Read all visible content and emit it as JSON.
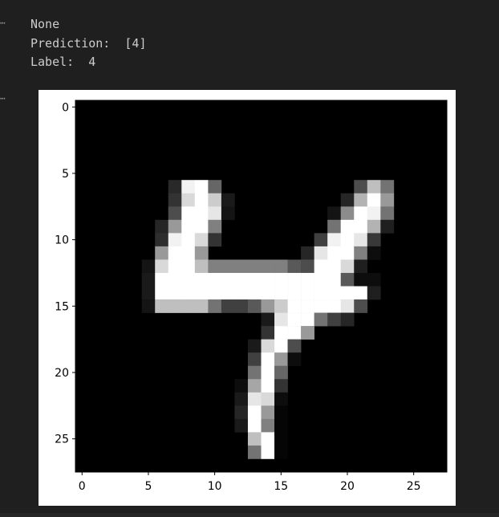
{
  "cells": [
    {
      "gutter_icon": "ellipsis-icon",
      "output_lines": [
        "None",
        "Prediction:  [4]",
        "Label:  4"
      ]
    },
    {
      "gutter_icon": "ellipsis-icon"
    }
  ],
  "chart_data": {
    "type": "heatmap",
    "colormap": "gray",
    "title": "",
    "xlabel": "",
    "ylabel": "",
    "xlim": [
      -0.5,
      27.5
    ],
    "ylim": [
      27.5,
      -0.5
    ],
    "x_ticks": [
      0,
      5,
      10,
      15,
      20,
      25
    ],
    "y_ticks": [
      0,
      5,
      10,
      15,
      20,
      25
    ],
    "grid": false,
    "pixels_nonzero": [
      [
        6,
        7,
        0.16
      ],
      [
        6,
        8,
        0.95
      ],
      [
        6,
        9,
        1.0
      ],
      [
        6,
        10,
        0.4
      ],
      [
        6,
        21,
        0.3
      ],
      [
        6,
        22,
        0.75
      ],
      [
        6,
        23,
        0.45
      ],
      [
        7,
        7,
        0.2
      ],
      [
        7,
        8,
        0.85
      ],
      [
        7,
        9,
        1.0
      ],
      [
        7,
        10,
        0.8
      ],
      [
        7,
        11,
        0.1
      ],
      [
        7,
        20,
        0.15
      ],
      [
        7,
        21,
        0.7
      ],
      [
        7,
        22,
        1.0
      ],
      [
        7,
        23,
        0.6
      ],
      [
        8,
        7,
        0.3
      ],
      [
        8,
        8,
        1.0
      ],
      [
        8,
        9,
        1.0
      ],
      [
        8,
        10,
        0.9
      ],
      [
        8,
        11,
        0.08
      ],
      [
        8,
        19,
        0.08
      ],
      [
        8,
        20,
        0.55
      ],
      [
        8,
        21,
        1.0
      ],
      [
        8,
        22,
        0.95
      ],
      [
        8,
        23,
        0.45
      ],
      [
        9,
        6,
        0.15
      ],
      [
        9,
        7,
        0.6
      ],
      [
        9,
        8,
        1.0
      ],
      [
        9,
        9,
        1.0
      ],
      [
        9,
        10,
        0.5
      ],
      [
        9,
        19,
        0.45
      ],
      [
        9,
        20,
        1.0
      ],
      [
        9,
        21,
        1.0
      ],
      [
        9,
        22,
        0.7
      ],
      [
        9,
        23,
        0.12
      ],
      [
        10,
        6,
        0.18
      ],
      [
        10,
        7,
        0.95
      ],
      [
        10,
        8,
        1.0
      ],
      [
        10,
        9,
        0.85
      ],
      [
        10,
        10,
        0.2
      ],
      [
        10,
        18,
        0.25
      ],
      [
        10,
        19,
        0.95
      ],
      [
        10,
        20,
        1.0
      ],
      [
        10,
        21,
        0.9
      ],
      [
        10,
        22,
        0.22
      ],
      [
        11,
        6,
        0.6
      ],
      [
        11,
        7,
        1.0
      ],
      [
        11,
        8,
        1.0
      ],
      [
        11,
        9,
        0.6
      ],
      [
        11,
        17,
        0.15
      ],
      [
        11,
        18,
        0.9
      ],
      [
        11,
        19,
        1.0
      ],
      [
        11,
        20,
        1.0
      ],
      [
        11,
        21,
        0.5
      ],
      [
        11,
        22,
        0.05
      ],
      [
        12,
        5,
        0.08
      ],
      [
        12,
        6,
        0.85
      ],
      [
        12,
        7,
        1.0
      ],
      [
        12,
        8,
        1.0
      ],
      [
        12,
        9,
        0.75
      ],
      [
        12,
        10,
        0.5
      ],
      [
        12,
        11,
        0.5
      ],
      [
        12,
        12,
        0.5
      ],
      [
        12,
        13,
        0.5
      ],
      [
        12,
        14,
        0.5
      ],
      [
        12,
        15,
        0.5
      ],
      [
        12,
        16,
        0.35
      ],
      [
        12,
        17,
        0.3
      ],
      [
        12,
        18,
        1.0
      ],
      [
        12,
        19,
        1.0
      ],
      [
        12,
        20,
        0.85
      ],
      [
        12,
        21,
        0.12
      ],
      [
        13,
        5,
        0.1
      ],
      [
        13,
        6,
        1.0
      ],
      [
        13,
        7,
        1.0
      ],
      [
        13,
        8,
        1.0
      ],
      [
        13,
        9,
        1.0
      ],
      [
        13,
        10,
        1.0
      ],
      [
        13,
        11,
        1.0
      ],
      [
        13,
        12,
        1.0
      ],
      [
        13,
        13,
        1.0
      ],
      [
        13,
        14,
        1.0
      ],
      [
        13,
        15,
        1.0
      ],
      [
        13,
        16,
        1.0
      ],
      [
        13,
        17,
        1.0
      ],
      [
        13,
        18,
        1.0
      ],
      [
        13,
        19,
        1.0
      ],
      [
        13,
        20,
        0.35
      ],
      [
        13,
        21,
        0.05
      ],
      [
        13,
        22,
        0.05
      ],
      [
        14,
        5,
        0.1
      ],
      [
        14,
        6,
        1.0
      ],
      [
        14,
        7,
        1.0
      ],
      [
        14,
        8,
        1.0
      ],
      [
        14,
        9,
        1.0
      ],
      [
        14,
        10,
        1.0
      ],
      [
        14,
        11,
        1.0
      ],
      [
        14,
        12,
        1.0
      ],
      [
        14,
        13,
        1.0
      ],
      [
        14,
        14,
        1.0
      ],
      [
        14,
        15,
        1.0
      ],
      [
        14,
        16,
        1.0
      ],
      [
        14,
        17,
        1.0
      ],
      [
        14,
        18,
        1.0
      ],
      [
        14,
        19,
        1.0
      ],
      [
        14,
        20,
        1.0
      ],
      [
        14,
        21,
        1.0
      ],
      [
        14,
        22,
        0.12
      ],
      [
        15,
        5,
        0.08
      ],
      [
        15,
        6,
        0.75
      ],
      [
        15,
        7,
        0.75
      ],
      [
        15,
        8,
        0.75
      ],
      [
        15,
        9,
        0.75
      ],
      [
        15,
        10,
        0.45
      ],
      [
        15,
        11,
        0.25
      ],
      [
        15,
        12,
        0.25
      ],
      [
        15,
        13,
        0.35
      ],
      [
        15,
        14,
        0.6
      ],
      [
        15,
        15,
        0.8
      ],
      [
        15,
        16,
        1.0
      ],
      [
        15,
        17,
        1.0
      ],
      [
        15,
        18,
        1.0
      ],
      [
        15,
        19,
        1.0
      ],
      [
        15,
        20,
        0.9
      ],
      [
        15,
        21,
        0.3
      ],
      [
        16,
        14,
        0.1
      ],
      [
        16,
        15,
        0.9
      ],
      [
        16,
        16,
        1.0
      ],
      [
        16,
        17,
        1.0
      ],
      [
        16,
        18,
        0.45
      ],
      [
        16,
        19,
        0.25
      ],
      [
        16,
        20,
        0.15
      ],
      [
        17,
        14,
        0.2
      ],
      [
        17,
        15,
        1.0
      ],
      [
        17,
        16,
        1.0
      ],
      [
        17,
        17,
        0.6
      ],
      [
        18,
        13,
        0.1
      ],
      [
        18,
        14,
        0.85
      ],
      [
        18,
        15,
        1.0
      ],
      [
        18,
        16,
        0.3
      ],
      [
        19,
        13,
        0.25
      ],
      [
        19,
        14,
        1.0
      ],
      [
        19,
        15,
        0.6
      ],
      [
        19,
        16,
        0.05
      ],
      [
        20,
        13,
        0.45
      ],
      [
        20,
        14,
        1.0
      ],
      [
        20,
        15,
        0.4
      ],
      [
        21,
        12,
        0.05
      ],
      [
        21,
        13,
        0.65
      ],
      [
        21,
        14,
        1.0
      ],
      [
        21,
        15,
        0.2
      ],
      [
        22,
        12,
        0.1
      ],
      [
        22,
        13,
        0.9
      ],
      [
        22,
        14,
        0.85
      ],
      [
        22,
        15,
        0.05
      ],
      [
        23,
        12,
        0.15
      ],
      [
        23,
        13,
        1.0
      ],
      [
        23,
        14,
        0.6
      ],
      [
        23,
        15,
        0.02
      ],
      [
        24,
        12,
        0.1
      ],
      [
        24,
        13,
        1.0
      ],
      [
        24,
        14,
        0.5
      ],
      [
        24,
        15,
        0.02
      ],
      [
        25,
        13,
        0.75
      ],
      [
        25,
        14,
        1.0
      ],
      [
        25,
        15,
        0.02
      ],
      [
        26,
        13,
        0.45
      ],
      [
        26,
        14,
        1.0
      ],
      [
        26,
        15,
        0.02
      ]
    ]
  }
}
